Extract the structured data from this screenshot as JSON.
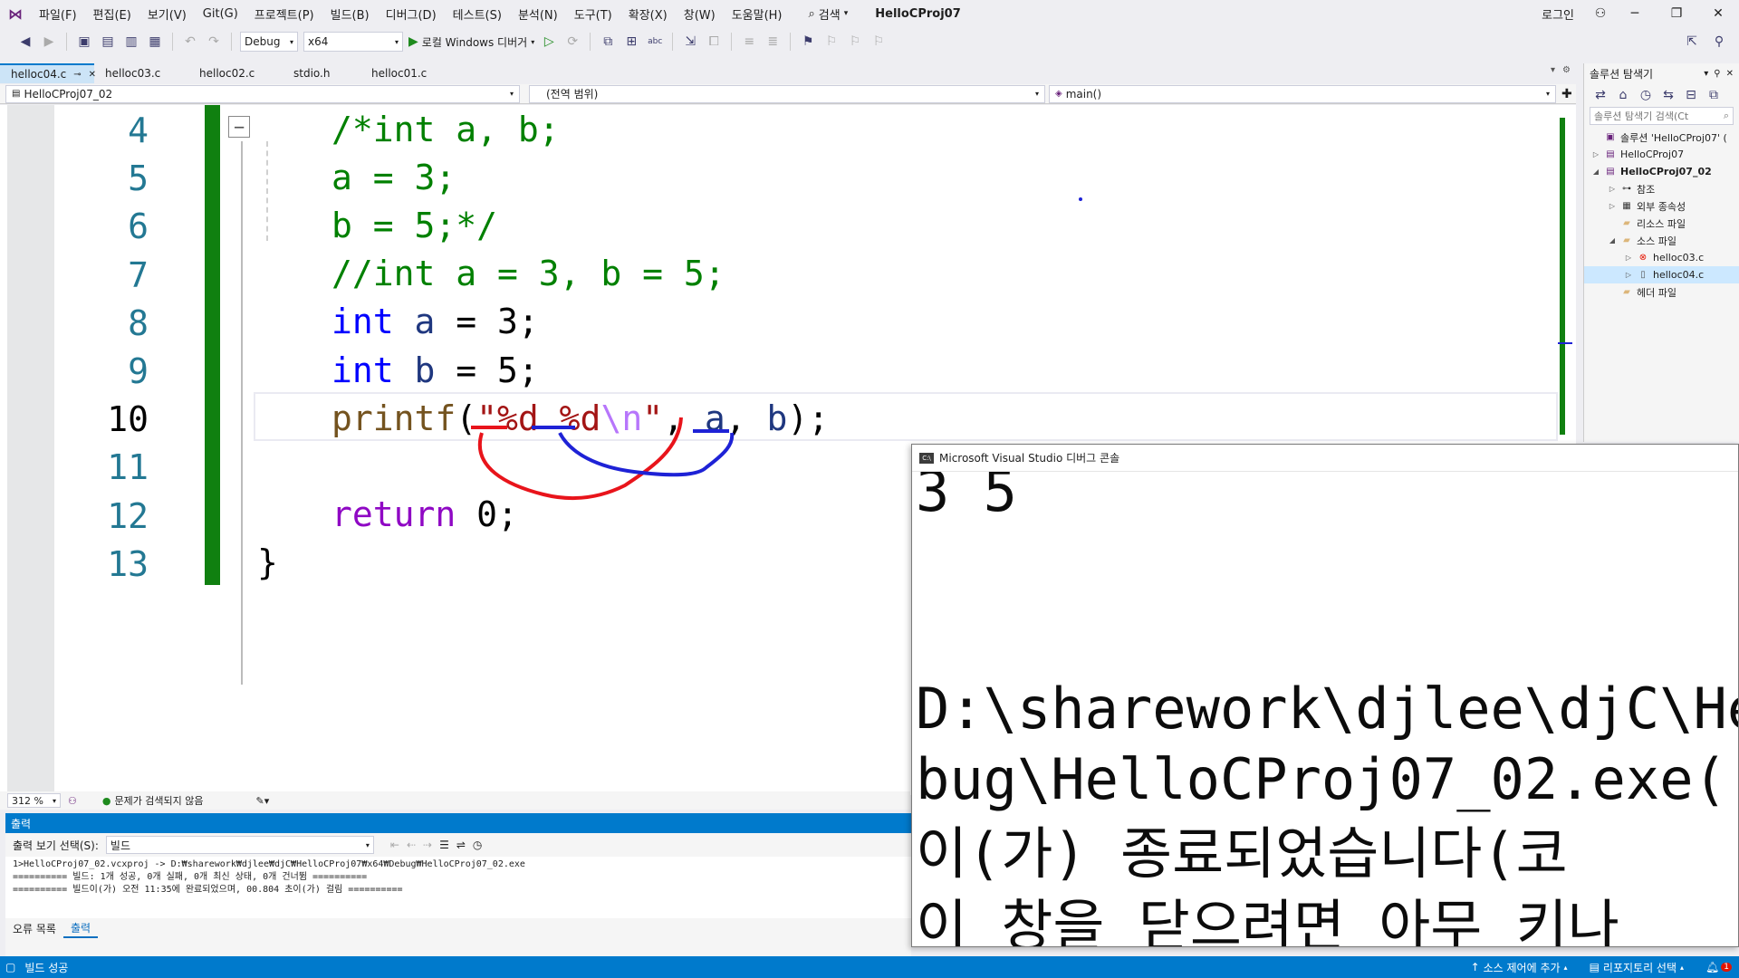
{
  "menu": {
    "items": [
      "파일(F)",
      "편집(E)",
      "보기(V)",
      "Git(G)",
      "프로젝트(P)",
      "빌드(B)",
      "디버그(D)",
      "테스트(S)",
      "분석(N)",
      "도구(T)",
      "확장(X)",
      "창(W)",
      "도움말(H)"
    ],
    "search_label": "검색",
    "project_title": "HelloCProj07",
    "login_label": "로그인"
  },
  "toolbar": {
    "config": "Debug",
    "platform": "x64",
    "run_label": "로컬 Windows 디버거"
  },
  "doc_tabs": [
    {
      "label": "helloc04.c",
      "pin": "⊸",
      "close": "✕"
    },
    {
      "label": "helloc03.c"
    },
    {
      "label": "helloc02.c"
    },
    {
      "label": "stdio.h"
    },
    {
      "label": "helloc01.c"
    }
  ],
  "navbar": {
    "project": "HelloCProj07_02",
    "scope": "(전역 범위)",
    "function": "main()"
  },
  "code": {
    "lines": [
      {
        "num": "4",
        "tokens": [
          {
            "t": "/*int a, b;",
            "c": "cm"
          }
        ]
      },
      {
        "num": "5",
        "tokens": [
          {
            "t": "a = 3;",
            "c": "cm"
          }
        ]
      },
      {
        "num": "6",
        "tokens": [
          {
            "t": "b = 5;*/",
            "c": "cm"
          }
        ]
      },
      {
        "num": "7",
        "tokens": [
          {
            "t": "//int a = 3, b = 5;",
            "c": "cm"
          }
        ]
      },
      {
        "num": "8",
        "tokens": [
          {
            "t": "int",
            "c": "kw"
          },
          {
            "t": " ",
            "c": "pl"
          },
          {
            "t": "a",
            "c": "var"
          },
          {
            "t": " = 3;",
            "c": "pl"
          }
        ]
      },
      {
        "num": "9",
        "tokens": [
          {
            "t": "int",
            "c": "kw"
          },
          {
            "t": " ",
            "c": "pl"
          },
          {
            "t": "b",
            "c": "var"
          },
          {
            "t": " = 5;",
            "c": "pl"
          }
        ]
      },
      {
        "num": "10",
        "tokens": [
          {
            "t": "printf",
            "c": "fn"
          },
          {
            "t": "(",
            "c": "pl"
          },
          {
            "t": "\"%d %d",
            "c": "str"
          },
          {
            "t": "\\n",
            "c": "esc"
          },
          {
            "t": "\"",
            "c": "str"
          },
          {
            "t": ", ",
            "c": "pl"
          },
          {
            "t": "a",
            "c": "var"
          },
          {
            "t": ", ",
            "c": "pl"
          },
          {
            "t": "b",
            "c": "var"
          },
          {
            "t": ");",
            "c": "pl"
          }
        ]
      },
      {
        "num": "11",
        "tokens": []
      },
      {
        "num": "12",
        "tokens": [
          {
            "t": "return",
            "c": "kw2"
          },
          {
            "t": " 0;",
            "c": "pl"
          }
        ]
      },
      {
        "num": "13",
        "tokens": [
          {
            "t": "}",
            "c": "pl"
          }
        ]
      }
    ],
    "current_line": "10",
    "collapse_glyph": "−"
  },
  "editor_status": {
    "zoom": "312 %",
    "issues": "문제가 검색되지 않음"
  },
  "output": {
    "header": "출력",
    "show_label": "출력 보기 선택(S):",
    "source": "빌드",
    "lines": [
      "1>HelloCProj07_02.vcxproj -> D:₩sharework₩djlee₩djC₩HelloCProj07₩x64₩Debug₩HelloCProj07_02.exe",
      "========== 빌드: 1개 성공, 0개 실패, 0개 최신 상태, 0개 건너뜀 ==========",
      "========== 빌드이(가) 오전 11:35에 완료되었으며, 00.804 초이(가) 걸림 =========="
    ],
    "tabs": [
      "오류 목록",
      "출력"
    ],
    "active_tab": "출력"
  },
  "statusbar": {
    "left": "빌드 성공",
    "source_control": "소스 제어에 추가",
    "repo": "리포지토리 선택",
    "notif_count": "1"
  },
  "solution_explorer": {
    "title": "솔루션 탐색기",
    "search_placeholder": "솔루션 탐색기 검색(Ct",
    "tree": [
      {
        "label": "솔루션 'HelloCProj07' (",
        "depth": 0,
        "arrow": "",
        "icon": "solution-icon"
      },
      {
        "label": "HelloCProj07",
        "depth": 0,
        "arrow": "▷",
        "icon": "project-icon"
      },
      {
        "label": "HelloCProj07_02",
        "depth": 0,
        "arrow": "◢",
        "icon": "project-icon",
        "bold": true
      },
      {
        "label": "참조",
        "depth": 1,
        "arrow": "▷",
        "icon": "references-icon"
      },
      {
        "label": "외부 종속성",
        "depth": 1,
        "arrow": "▷",
        "icon": "dependencies-icon"
      },
      {
        "label": "리소스 파일",
        "depth": 1,
        "arrow": "",
        "icon": "folder-icon"
      },
      {
        "label": "소스 파일",
        "depth": 1,
        "arrow": "◢",
        "icon": "folder-icon"
      },
      {
        "label": "helloc03.c",
        "depth": 2,
        "arrow": "▷",
        "icon": "c-file-error-icon"
      },
      {
        "label": "helloc04.c",
        "depth": 2,
        "arrow": "▷",
        "icon": "c-file-icon",
        "selected": true
      },
      {
        "label": "헤더 파일",
        "depth": 1,
        "arrow": "",
        "icon": "folder-icon"
      }
    ]
  },
  "console": {
    "title": "Microsoft Visual Studio 디버그 콘솔",
    "lines": [
      "3 5",
      "",
      "",
      "D:\\sharework\\djlee\\djC\\He",
      "bug\\HelloCProj07_02.exe(",
      "이(가) 종료되었습니다(코",
      "이 창을 닫으려면 아무 키나"
    ]
  },
  "colors": {
    "accent": "#007acc",
    "change_bar": "#108010",
    "annotation_red": "#e8141b",
    "annotation_blue": "#1e22d6"
  }
}
